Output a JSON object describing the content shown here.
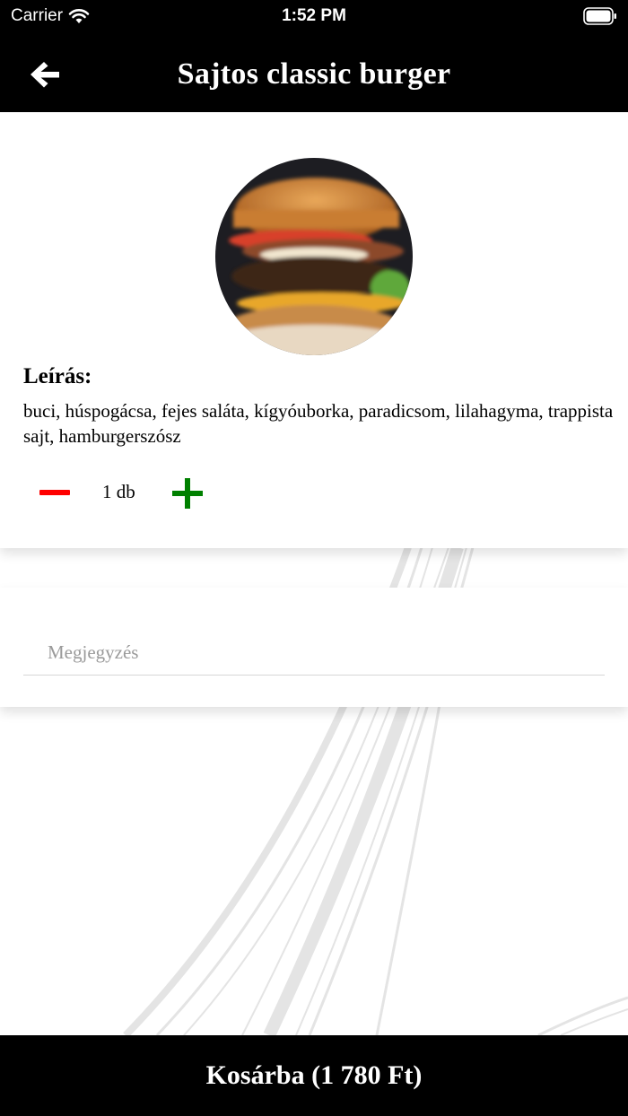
{
  "status_bar": {
    "carrier": "Carrier",
    "time": "1:52 PM"
  },
  "header": {
    "title": "Sajtos classic burger",
    "back_icon": "arrow-left-icon"
  },
  "product": {
    "image_alt": "burger-image",
    "description_heading": "Leírás:",
    "description": "buci, húspogácsa, fejes saláta, kígyóuborka, paradicsom, lilahagyma, trappista sajt, hamburgerszósz",
    "quantity_label": "1 db",
    "quantity": 1
  },
  "note": {
    "placeholder": "Megjegyzés",
    "value": ""
  },
  "cart_button": {
    "label": "Kosárba (1 780 Ft)"
  },
  "colors": {
    "bar_background": "#000000",
    "minus": "#ff0000",
    "plus": "#008000"
  }
}
